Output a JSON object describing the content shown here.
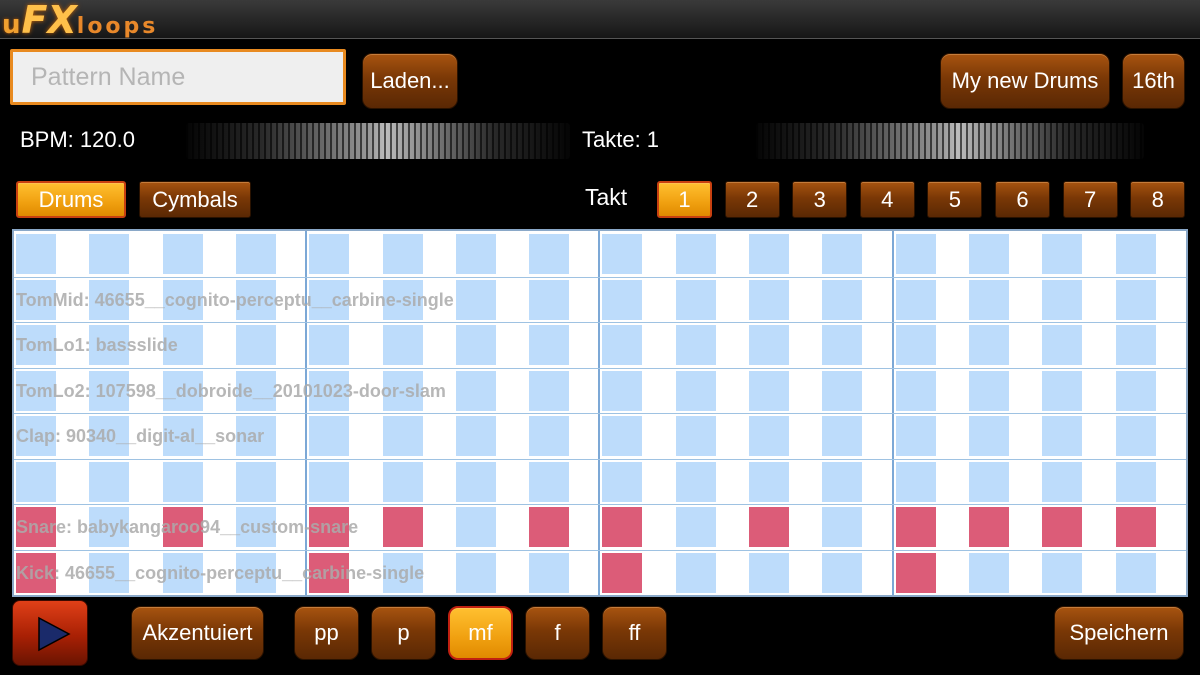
{
  "app": {
    "logo_small": "u",
    "logo_big": "FX",
    "logo_tail": "loops"
  },
  "toolbar": {
    "pattern_name_placeholder": "Pattern Name",
    "load_label": "Laden...",
    "kit_label": "My new Drums",
    "resolution_label": "16th"
  },
  "controls": {
    "bpm_label": "BPM: 120.0",
    "bars_label": "Takte: 1"
  },
  "tabs": [
    {
      "label": "Drums",
      "selected": true
    },
    {
      "label": "Cymbals",
      "selected": false
    }
  ],
  "bar_selector": {
    "label": "Takt",
    "bars": [
      "1",
      "2",
      "3",
      "4",
      "5",
      "6",
      "7",
      "8"
    ],
    "selected": "1"
  },
  "grid": {
    "steps": 16,
    "rows": [
      {
        "label": "",
        "on": []
      },
      {
        "label": "TomMid: 46655__cognito-perceptu__carbine-single",
        "on": []
      },
      {
        "label": "TomLo1: bassslide",
        "on": []
      },
      {
        "label": "TomLo2: 107598__dobroide__20101023-door-slam",
        "on": []
      },
      {
        "label": "Clap: 90340__digit-al__sonar",
        "on": []
      },
      {
        "label": "",
        "on": []
      },
      {
        "label": "Snare: babykangaroo94__custom-snare",
        "on": [
          0,
          2,
          4,
          5,
          7,
          8,
          10,
          12,
          13,
          14,
          15
        ]
      },
      {
        "label": "Kick: 46655__cognito-perceptu__carbine-single",
        "on": [
          0,
          4,
          8,
          12
        ]
      }
    ]
  },
  "bottom": {
    "accent_label": "Akzentuiert",
    "dynamics": [
      "pp",
      "p",
      "mf",
      "f",
      "ff"
    ],
    "selected_dynamic": "mf",
    "save_label": "Speichern"
  },
  "colors": {
    "accent": "#f0a010",
    "button": "#7a3806",
    "cell_off": "#bddcfb",
    "cell_on": "#dc5c78"
  }
}
